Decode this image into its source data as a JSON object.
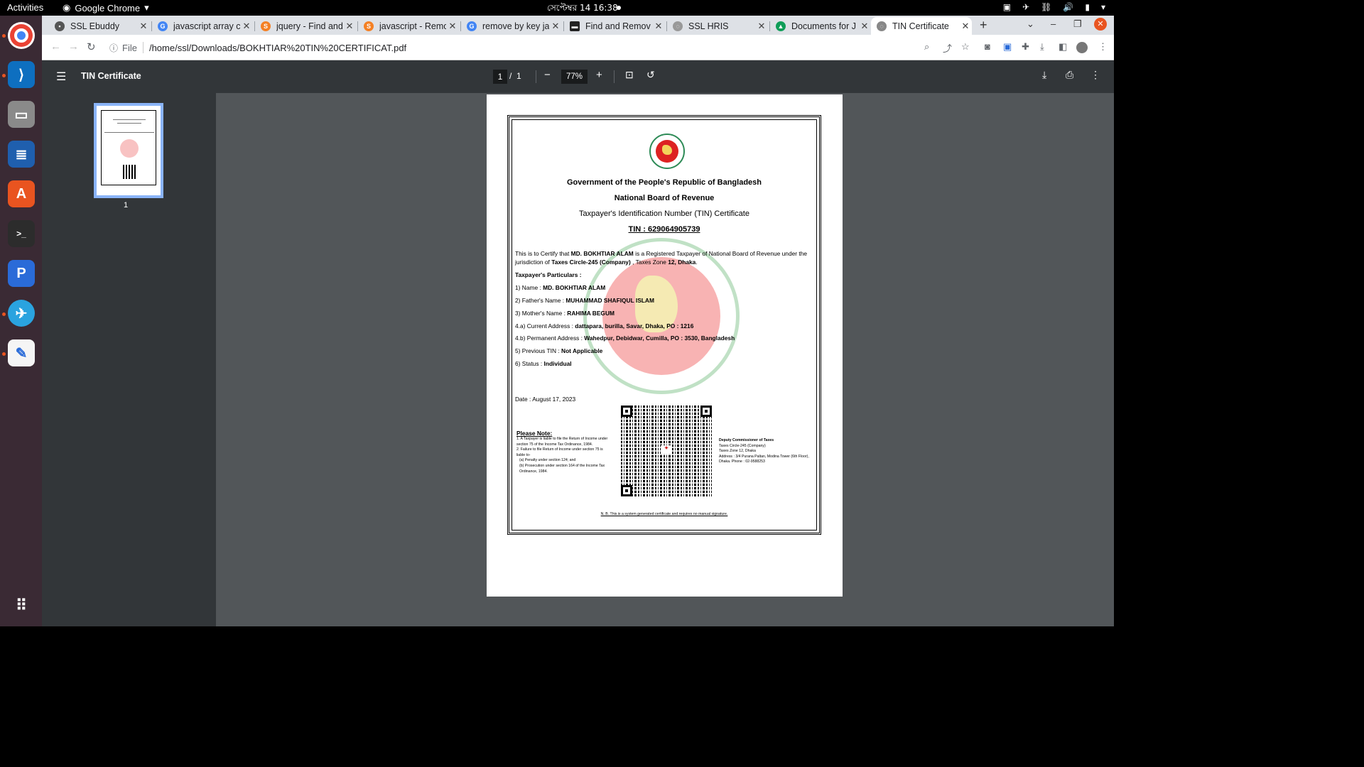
{
  "topbar": {
    "activities": "Activities",
    "app_name": "Google Chrome",
    "clock": "সেপ্টেম্বর 14  16:38"
  },
  "dock": {
    "items": [
      "chrome-icon",
      "vscode-icon",
      "files-icon",
      "writer-icon",
      "software-icon",
      "terminal-icon",
      "pycharm-icon",
      "telegram-icon",
      "text-editor-icon",
      "apps-grid-icon"
    ]
  },
  "tabs": [
    {
      "label": "SSL Ebuddy"
    },
    {
      "label": "javascript array c"
    },
    {
      "label": "jquery - Find and"
    },
    {
      "label": "javascript - Remo"
    },
    {
      "label": "remove by key ja"
    },
    {
      "label": "Find and Remov"
    },
    {
      "label": "SSL HRIS"
    },
    {
      "label": "Documents for J"
    },
    {
      "label": "TIN Certificate"
    }
  ],
  "omnibox": {
    "scheme": "File",
    "url": "/home/ssl/Downloads/BOKHTIAR%20TIN%20CERTIFICAT.pdf"
  },
  "pdf_toolbar": {
    "title": "TIN Certificate",
    "page": "1",
    "page_sep": "/",
    "page_total": "1",
    "zoom": "77%"
  },
  "thumbnail": {
    "page_number": "1"
  },
  "document": {
    "heading1": "Government of the People's Republic of Bangladesh",
    "heading2": "National Board of Revenue",
    "heading3": "Taxpayer's Identification Number (TIN) Certificate",
    "tin": "TIN : 629064905739",
    "cert_text_1": "This is to Certify that ",
    "cert_name": "MD. BOKHTIAR ALAM",
    "cert_text_2": " is a Registered Taxpayer of National Board of Revenue under the jurisdiction of ",
    "cert_circle": "Taxes Circle-245 (Company)",
    "cert_text_3": " , Taxes Zone ",
    "cert_zone": "12, Dhaka",
    "cert_text_4": ".",
    "particulars_heading": "Taxpayer's Particulars :",
    "particulars": [
      {
        "label": "1) Name : ",
        "value": "MD. BOKHTIAR ALAM"
      },
      {
        "label": "2) Father's Name : ",
        "value": "MUHAMMAD SHAFIQUL ISLAM"
      },
      {
        "label": "3) Mother's Name : ",
        "value": "RAHIMA BEGUM"
      },
      {
        "label": "4.a) Current Address : ",
        "value": "dattapara, burilla, Savar, Dhaka, PO : 1216"
      },
      {
        "label": "4.b) Permanent Address : ",
        "value": "Wahedpur, Debidwar, Cumilla, PO : 3530, Bangladesh"
      },
      {
        "label": "5) Previous TIN : ",
        "value": "Not Applicable"
      },
      {
        "label": "6) Status : ",
        "value": "Individual"
      }
    ],
    "date": "Date : August 17, 2023",
    "note_heading": "Please Note:",
    "notes": [
      "1. A Taxpayer is liable to file the Return of Income under section 75 of the Income Tax Ordinance, 1984.",
      "2. Failure to file Return of Income under section 75 is liable to-",
      "(a) Penalty under section 124; and",
      "(b) Prosecution under section 164 of the Income Tax Ordinance, 1984."
    ],
    "officer": {
      "title": "Deputy Commissioner of Taxes",
      "circle": "Taxes Circle-245 (Company)",
      "zone": "Taxes Zone 12, Dhaka",
      "address": "Address : 3/4 Purana Paltan, Modina Tower (6th Floor), Dhaka. Phone : 02-9588253"
    },
    "footer_note": "N. B. This is a system generated certificate and requires no manual signature."
  }
}
